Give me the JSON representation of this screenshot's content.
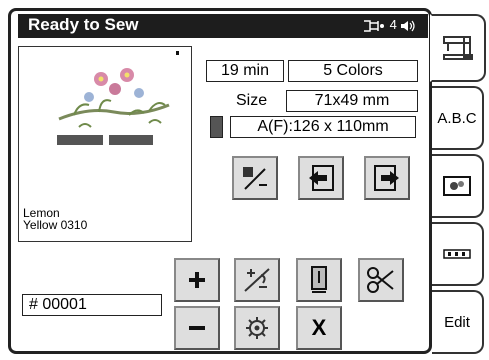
{
  "header": {
    "title": "Ready to Sew",
    "thread_status": "4",
    "thread_icon": "thread-spool-icon",
    "speaker_icon": "speaker-icon"
  },
  "preview": {
    "thread_color_name": "Lemon",
    "thread_color_code": "Yellow 0310"
  },
  "info": {
    "time": "19 min",
    "colors": "5 Colors",
    "size_label": "Size",
    "size": "71x49 mm",
    "hoop": "A(F):126 x 110mm"
  },
  "controls": {
    "stitch_number": "# 00001",
    "cancel_label": "X"
  },
  "tabs": {
    "text_tab": "A.B.C",
    "edit_tab": "Edit"
  },
  "colors": {
    "title_bar": "#1d1d1d",
    "button_face": "#dedede"
  }
}
